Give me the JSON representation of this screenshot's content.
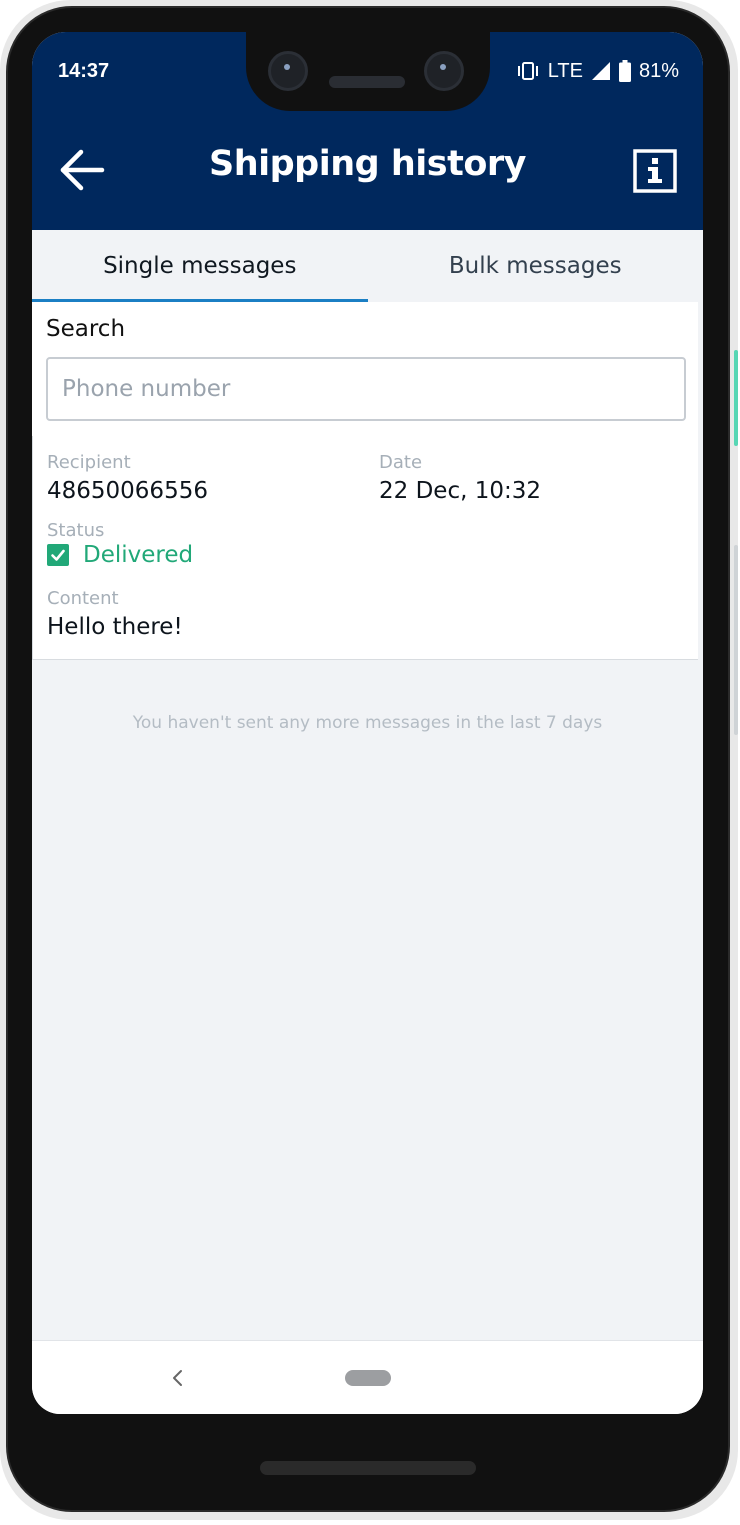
{
  "status_bar": {
    "time": "14:37",
    "network": "LTE",
    "battery": "81%"
  },
  "header": {
    "title": "Shipping history",
    "back_icon": "arrow-left-icon",
    "info_icon": "info-icon"
  },
  "tabs": [
    {
      "label": "Single messages",
      "active": true
    },
    {
      "label": "Bulk messages",
      "active": false
    }
  ],
  "search": {
    "label": "Search",
    "placeholder": "Phone number",
    "value": ""
  },
  "message": {
    "recipient_label": "Recipient",
    "recipient_value": "48650066556",
    "date_label": "Date",
    "date_value": "22 Dec, 10:32",
    "status_label": "Status",
    "status_value": "Delivered",
    "content_label": "Content",
    "content_value": "Hello there!"
  },
  "empty_note": "You haven't sent any more messages in the last 7 days",
  "colors": {
    "header_bg": "#00285d",
    "tab_indicator": "#1b7fc4",
    "delivered_green": "#21a878"
  }
}
